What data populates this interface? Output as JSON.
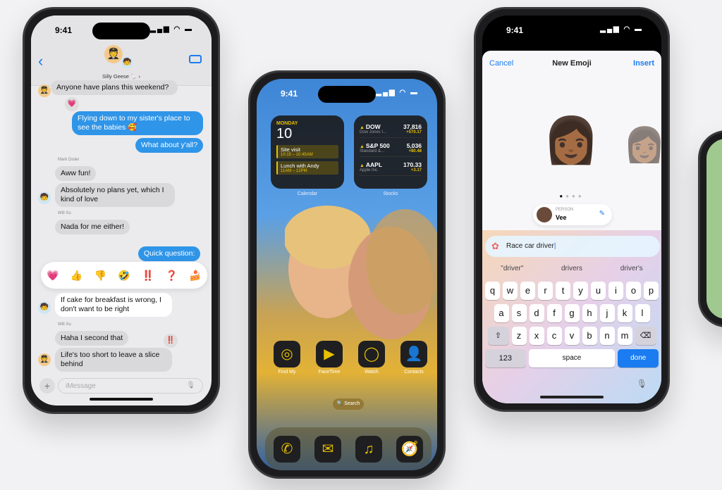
{
  "status_time": "9:41",
  "messages": {
    "group_name": "Silly Geese 🪿 ›",
    "items": [
      {
        "sender": "",
        "text": "Anyone have plans this weekend?",
        "dir": "in"
      },
      {
        "sender": "",
        "text": "Flying down to my sister's place to see the babies 🥰",
        "dir": "out",
        "tapback": "💗"
      },
      {
        "sender": "",
        "text": "What about y'all?",
        "dir": "out"
      },
      {
        "sender": "Mark Disler",
        "text": "Aww fun!",
        "dir": "in"
      },
      {
        "sender": "",
        "text": "Absolutely no plans yet, which I kind of love",
        "dir": "in"
      },
      {
        "sender": "Will Xu",
        "text": "Nada for me either!",
        "dir": "in"
      },
      {
        "sender": "",
        "text": "Quick question:",
        "dir": "out"
      },
      {
        "sender": "",
        "text": "If cake for breakfast is wrong, I don't want to be right",
        "dir": "in"
      },
      {
        "sender": "Will Xu",
        "text": "Haha I second that",
        "dir": "in"
      },
      {
        "sender": "",
        "text": "Life's too short to leave a slice behind",
        "dir": "in",
        "tapback": "‼️"
      }
    ],
    "tapbacks": [
      "💗",
      "👍",
      "👎",
      "🤣",
      "‼️",
      "❓",
      "🍰"
    ],
    "compose_placeholder": "iMessage"
  },
  "home": {
    "calendar": {
      "day": "MONDAY",
      "date": "10",
      "events": [
        {
          "title": "Site visit",
          "time": "10:15 – 10:45AM"
        },
        {
          "title": "Lunch with Andy",
          "time": "11AM – 12PM"
        }
      ],
      "label": "Calendar"
    },
    "stocks": {
      "items": [
        {
          "sym": "DOW",
          "name": "Dow Jones I...",
          "price": "37,816",
          "change": "+570.17"
        },
        {
          "sym": "S&P 500",
          "name": "Standard &...",
          "price": "5,036",
          "change": "+80.48"
        },
        {
          "sym": "AAPL",
          "name": "Apple Inc.",
          "price": "170.33",
          "change": "+3.17"
        }
      ],
      "label": "Stocks"
    },
    "apps": [
      {
        "name": "Find My",
        "icon": "◎"
      },
      {
        "name": "FaceTime",
        "icon": "▶"
      },
      {
        "name": "Watch",
        "icon": "◯"
      },
      {
        "name": "Contacts",
        "icon": "👤"
      }
    ],
    "search": "🔍 Search",
    "dock": [
      {
        "name": "phone-icon",
        "icon": "✆"
      },
      {
        "name": "mail-icon",
        "icon": "✉"
      },
      {
        "name": "music-icon",
        "icon": "♫"
      },
      {
        "name": "safari-icon",
        "icon": "🧭"
      }
    ]
  },
  "emoji": {
    "cancel": "Cancel",
    "title": "New Emoji",
    "insert": "Insert",
    "person_label": "PERSON",
    "person_name": "Vee",
    "prompt": "Race car driver",
    "suggestions": [
      "\"driver\"",
      "drivers",
      "driver's"
    ],
    "rows": [
      [
        "q",
        "w",
        "e",
        "r",
        "t",
        "y",
        "u",
        "i",
        "o",
        "p"
      ],
      [
        "a",
        "s",
        "d",
        "f",
        "g",
        "h",
        "j",
        "k",
        "l"
      ],
      [
        "z",
        "x",
        "c",
        "v",
        "b",
        "n",
        "m"
      ]
    ],
    "shift": "⇧",
    "delete": "⌫",
    "numbers": "123",
    "space": "space",
    "done": "done",
    "accent": "#1a7cf0"
  }
}
